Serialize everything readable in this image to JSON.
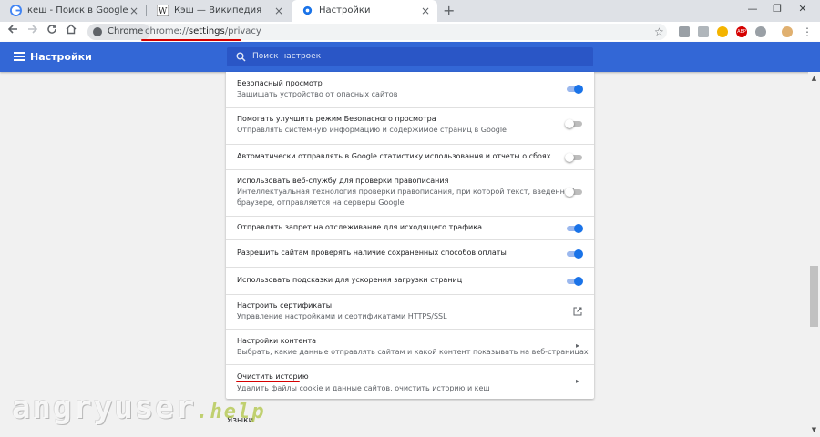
{
  "tabs": [
    {
      "title": "кеш - Поиск в Google",
      "icon": "google-icon"
    },
    {
      "title": "Кэш — Википедия",
      "icon": "wikipedia-icon"
    },
    {
      "title": "Настройки",
      "icon": "gear-icon"
    }
  ],
  "tab_close_glyph": "×",
  "new_tab_glyph": "+",
  "window": {
    "minimize": "—",
    "maximize": "❐",
    "close": "✕"
  },
  "toolbar": {
    "chip_label": "Chrome",
    "url_prefix": "chrome://",
    "url_path": "settings",
    "url_suffix": "/privacy",
    "bookmark_glyph": "☆",
    "menu_glyph": "⋮"
  },
  "extensions": [
    {
      "icon": "extension-puzzle-icon",
      "color": "#9aa0a6"
    },
    {
      "icon": "extension-document-icon",
      "color": "#b0b6bb"
    },
    {
      "icon": "extension-coin-icon",
      "color": "#f4b400"
    },
    {
      "icon": "adblock-icon",
      "color": "#d50000",
      "label": "ABP"
    },
    {
      "icon": "extension-globe-icon",
      "color": "#9aa0a6"
    },
    {
      "icon": "profile-avatar-icon",
      "color": "#e0b070"
    }
  ],
  "appbar": {
    "title": "Настройки",
    "search_placeholder": "Поиск настроек",
    "color": "#3367d6"
  },
  "rows": [
    {
      "title": "Безопасный просмотр",
      "subtitle": "Защищать устройство от опасных сайтов",
      "control": "toggle",
      "on": true
    },
    {
      "title": "Помогать улучшить режим Безопасного просмотра",
      "subtitle": "Отправлять системную информацию и содержимое страниц в Google",
      "control": "toggle",
      "on": false
    },
    {
      "title": "Автоматически отправлять в Google статистику использования и отчеты о сбоях",
      "control": "toggle",
      "on": false
    },
    {
      "title": "Использовать веб-службу для проверки правописания",
      "subtitle": "Интеллектуальная технология проверки правописания, при которой текст, введенный в",
      "subtitle2": "браузере, отправляется на серверы Google",
      "control": "toggle",
      "on": false
    },
    {
      "title": "Отправлять запрет на отслеживание для исходящего трафика",
      "control": "toggle",
      "on": true
    },
    {
      "title": "Разрешить сайтам проверять наличие сохраненных способов оплаты",
      "control": "toggle",
      "on": true
    },
    {
      "title": "Использовать подсказки для ускорения загрузки страниц",
      "control": "toggle",
      "on": true
    },
    {
      "title": "Настроить сертификаты",
      "subtitle": "Управление настройками и сертификатами HTTPS/SSL",
      "control": "external"
    },
    {
      "title": "Настройки контента",
      "subtitle": "Выбрать, какие данные отправлять сайтам и какой контент показывать на веб-страницах",
      "control": "arrow"
    },
    {
      "title": "Очистить историю",
      "subtitle": "Удалить файлы cookie и данные сайтов, очистить историю и кеш",
      "control": "arrow"
    }
  ],
  "chevron_glyph": "▸",
  "next_section": "Языки",
  "watermark": {
    "main": "angryuser",
    "suffix": ".help"
  },
  "colors": {
    "accent": "#1a73e8",
    "highlight": "#d50000"
  }
}
